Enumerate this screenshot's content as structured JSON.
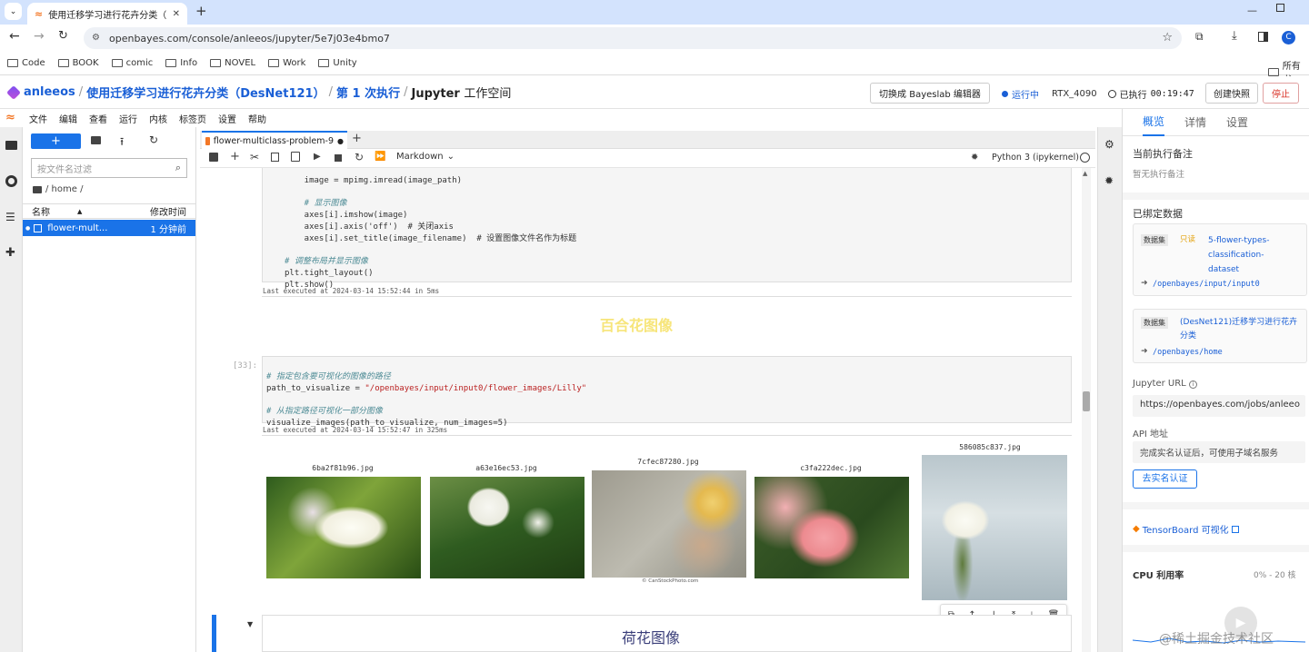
{
  "browser": {
    "tab_title": "使用迁移学习进行花卉分类（D",
    "url": "openbayes.com/console/anleeos/jupyter/5e7j03e4bmo7",
    "profile_initial": "C",
    "bookmarks": [
      "Code",
      "BOOK",
      "comic",
      "Info",
      "NOVEL",
      "Work",
      "Unity"
    ],
    "other_bookmarks": "所有书"
  },
  "app": {
    "user": "anleeos",
    "project": "使用迁移学习进行花卉分类（DesNet121）",
    "run": "第 1 次执行",
    "workspace_prefix": "Jupyter",
    "workspace_suffix": "工作空间",
    "switch_button": "切换成 Bayeslab 编辑器",
    "status": "运行中",
    "gpu": "RTX_4090",
    "elapsed_label": "已执行",
    "elapsed": "00:19:47",
    "snapshot_button": "创建快照",
    "stop_button": "停止",
    "status_color": "#1a5fd6",
    "accent": "#1a73e8"
  },
  "menu": [
    "文件",
    "编辑",
    "查看",
    "运行",
    "内核",
    "标签页",
    "设置",
    "帮助"
  ],
  "filebrowser": {
    "new_label": "+",
    "filter_placeholder": "按文件名过滤",
    "path": "/ home /",
    "col_name": "名称",
    "col_modified": "修改时间",
    "file_name": "flower-mult...",
    "file_modified": "1 分钟前"
  },
  "notebook": {
    "tab_label": "flower-multiclass-problem-9",
    "cell_type": "Markdown",
    "kernel": "Python 3 (ipykernel)",
    "code1_lines": [
      "    image = mpimg.imread(image_path)",
      "",
      "    # 显示图像",
      "    axes[i].imshow(image)",
      "    axes[i].axis('off')  # 关闭axis",
      "    axes[i].set_title(image_filename)  # 设置图像文件名作为标题",
      "",
      "# 调整布局并显示图像",
      "plt.tight_layout()",
      "plt.show()"
    ],
    "exec1": "Last executed at 2024-03-14 15:52:44 in 5ms",
    "heading_lily": "百合花图像",
    "prompt2": "[33]:",
    "code2_comment1": "# 指定包含要可视化的图像的路径",
    "code2_var": "path_to_visualize = ",
    "code2_str": "\"/openbayes/input/input0/flower_images/Lilly\"",
    "code2_comment2": "# 从指定路径可视化一部分图像",
    "code2_call": "visualize_images(path_to_visualize, num_images=5)",
    "exec2": "Last executed at 2024-03-14 15:52:47 in 325ms",
    "images": [
      {
        "title": "6ba2f81b96.jpg"
      },
      {
        "title": "a63e16ec53.jpg"
      },
      {
        "title": "7cfec87280.jpg"
      },
      {
        "title": "c3fa222dec.jpg"
      },
      {
        "title": "586085c837.jpg"
      }
    ],
    "watermark_small": "© CanStockPhoto.com",
    "heading_lotus": "荷花图像"
  },
  "rightpanel": {
    "tabs": [
      "概览",
      "详情",
      "设置"
    ],
    "note_title": "当前执行备注",
    "note_empty": "暂无执行备注",
    "bound_title": "已绑定数据",
    "ds1_tag": "数据集",
    "ds1_ro": "只读",
    "ds1_name": "5-flower-types-classification-dataset",
    "ds1_path": "/openbayes/input/input0",
    "ds2_tag": "数据集",
    "ds2_name": "(DesNet121)迁移学习进行花卉分类",
    "ds2_path": "/openbayes/home",
    "jupyter_url_label": "Jupyter URL",
    "jupyter_url": "https://openbayes.com/jobs/anleeo",
    "api_label": "API 地址",
    "api_value": "完成实名认证后，可使用子域名服务",
    "verify_button": "去实名认证",
    "tensorboard": "TensorBoard 可视化",
    "cpu_label": "CPU 利用率",
    "cpu_range": "0% - 20 核"
  },
  "watermark": "@稀土掘金技术社区"
}
